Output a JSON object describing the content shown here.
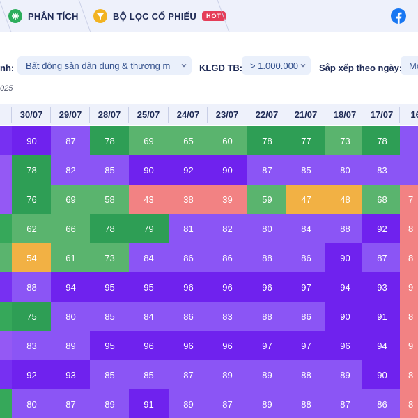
{
  "nav": {
    "tabs": [
      {
        "label": "PHÂN TÍCH",
        "icon": "analysis-icon"
      },
      {
        "label": "BỘ LỌC CỔ PHIẾU",
        "icon": "filter-icon",
        "badge": "HOT"
      }
    ],
    "social_icon": "facebook-icon"
  },
  "filters": {
    "sector_label_fragment": "nh:",
    "sector_value": "Bất động sản dân dụng & thương m",
    "klgd_label": "KLGD TB:",
    "klgd_value": "> 1.000.000",
    "sort_label": "Sắp xếp theo ngày:",
    "sort_value": "Mớ",
    "date_note": "025"
  },
  "table": {
    "partial_left_header": "",
    "dates": [
      "30/07",
      "29/07",
      "28/07",
      "25/07",
      "24/07",
      "23/07",
      "22/07",
      "21/07",
      "18/07",
      "17/07",
      "16/0"
    ],
    "rows": [
      [
        90,
        87,
        78,
        69,
        65,
        60,
        78,
        77,
        73,
        78,
        null
      ],
      [
        78,
        82,
        85,
        90,
        92,
        90,
        87,
        85,
        80,
        83,
        null
      ],
      [
        76,
        69,
        58,
        43,
        38,
        39,
        59,
        47,
        48,
        68,
        7
      ],
      [
        62,
        66,
        78,
        79,
        81,
        82,
        80,
        84,
        88,
        92,
        8
      ],
      [
        54,
        61,
        73,
        84,
        86,
        86,
        88,
        86,
        90,
        87,
        8
      ],
      [
        88,
        94,
        95,
        95,
        96,
        96,
        96,
        97,
        94,
        93,
        9
      ],
      [
        75,
        80,
        85,
        84,
        86,
        83,
        88,
        86,
        90,
        91,
        8
      ],
      [
        83,
        89,
        95,
        96,
        96,
        96,
        97,
        97,
        96,
        94,
        9
      ],
      [
        92,
        93,
        85,
        85,
        87,
        89,
        89,
        88,
        89,
        90,
        8
      ],
      [
        80,
        87,
        89,
        91,
        89,
        87,
        89,
        88,
        87,
        86,
        8
      ]
    ],
    "left_edge_colors": [
      "#7730f2",
      "#9459f4",
      "#9459f4",
      "#36a85a",
      "#5ab46e",
      "#7730f2",
      "#36a85a",
      "#9459f4",
      "#7730f2",
      "#36a85a"
    ],
    "colors": {
      "deep_purple": "#6f22ee",
      "purple": "#8b55f5",
      "dark_green": "#2e9e55",
      "green": "#5ab46e",
      "salmon": "#f28283",
      "amber": "#f2b144"
    }
  }
}
